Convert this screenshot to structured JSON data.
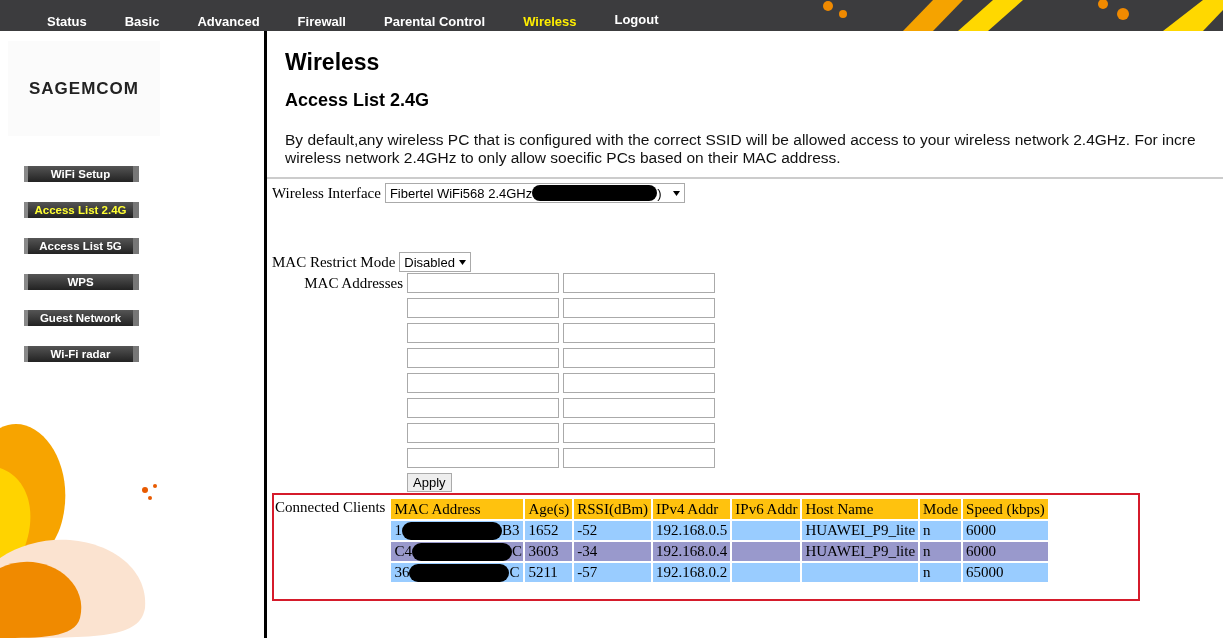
{
  "nav": [
    {
      "label": "Status",
      "selected": false
    },
    {
      "label": "Basic",
      "selected": false
    },
    {
      "label": "Advanced",
      "selected": false
    },
    {
      "label": "Firewall",
      "selected": false
    },
    {
      "label": "Parental Control",
      "selected": false
    },
    {
      "label": "Wireless",
      "selected": true
    },
    {
      "label": "Logout",
      "selected": false
    }
  ],
  "logo": "SAGEMCOM",
  "sidebar": {
    "items": [
      {
        "label": "WiFi Setup",
        "selected": false
      },
      {
        "label": "Access List 2.4G",
        "selected": true
      },
      {
        "label": "Access List 5G",
        "selected": false
      },
      {
        "label": "WPS",
        "selected": false
      },
      {
        "label": "Guest Network",
        "selected": false
      },
      {
        "label": "Wi-Fi radar",
        "selected": false
      }
    ]
  },
  "page_title": "Wireless",
  "section_title": "Access List 2.4G",
  "description": [
    "By default,any wireless PC that is configured with the correct SSID will be allowed access to your wireless network 2.4GHz. For incre",
    "wireless network 2.4GHz to only allow soecific PCs based on their MAC address."
  ],
  "wireless_interface": {
    "label": "Wireless Interface",
    "value_start": "Fibertel WiFi568 2.4GHz",
    "value_end": ")"
  },
  "mac_restrict_mode": {
    "label": "MAC Restrict Mode",
    "value": "Disabled"
  },
  "mac_addresses": {
    "label": "MAC Addresses",
    "apply": "Apply"
  },
  "connected_clients": {
    "label": "Connected Clients",
    "columns": [
      "MAC Address",
      "Age(s)",
      "RSSI(dBm)",
      "IPv4 Addr",
      "IPv6 Addr",
      "Host Name",
      "Mode",
      "Speed (kbps)"
    ],
    "rows": [
      {
        "mac_start": "1",
        "mac_end": "B3",
        "age": "1652",
        "rssi": "-52",
        "ipv4": "192.168.0.5",
        "ipv6": "",
        "host": "HUAWEI_P9_lite",
        "mode": "n",
        "speed": "6000"
      },
      {
        "mac_start": "C4",
        "mac_end": "C",
        "age": "3603",
        "rssi": "-34",
        "ipv4": "192.168.0.4",
        "ipv6": "",
        "host": "HUAWEI_P9_lite",
        "mode": "n",
        "speed": "6000"
      },
      {
        "mac_start": "36",
        "mac_end": "C",
        "age": "5211",
        "rssi": "-57",
        "ipv4": "192.168.0.2",
        "ipv6": "",
        "host": "",
        "mode": "n",
        "speed": "65000"
      }
    ]
  }
}
